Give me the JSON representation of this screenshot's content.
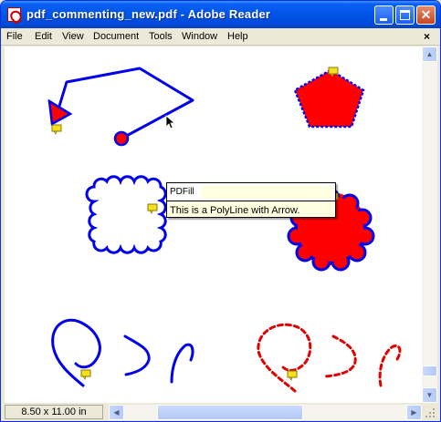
{
  "window": {
    "title": "pdf_commenting_new.pdf - Adobe Reader"
  },
  "titlebar_buttons": {
    "minimize": "minimize-icon",
    "maximize": "maximize-icon",
    "close": "close-icon"
  },
  "menubar": {
    "items": [
      "File",
      "Edit",
      "View",
      "Document",
      "Tools",
      "Window",
      "Help"
    ],
    "close_glyph": "×"
  },
  "tooltip": {
    "author": "PDFill",
    "text": "This is a PolyLine with Arrow."
  },
  "status": {
    "page_size": "8.50 x 11.00 in"
  },
  "colors": {
    "shape_stroke": "#0000ee",
    "shape_fill": "#ff0000",
    "dashed_stroke": "#e00000",
    "note_icon": "#f5e020",
    "titlebar": "#0055e5"
  }
}
